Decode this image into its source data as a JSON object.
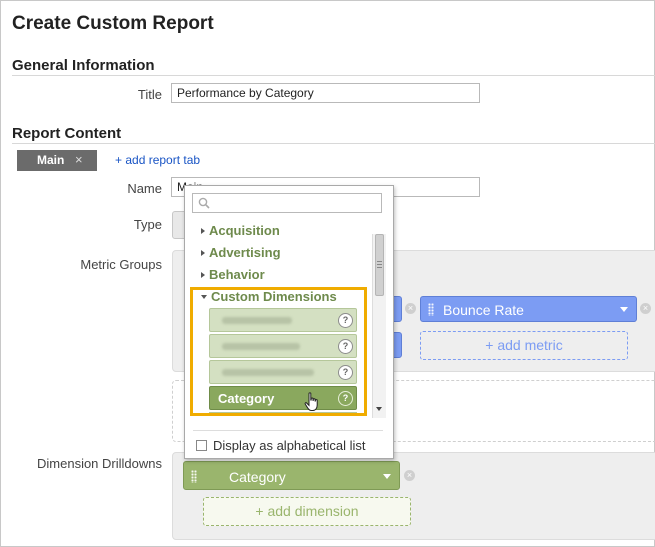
{
  "page": {
    "title": "Create Custom Report",
    "general_section": "General Information",
    "content_section": "Report Content"
  },
  "general": {
    "title_label": "Title",
    "title_value": "Performance by Category"
  },
  "tabs": {
    "active_tab": "Main",
    "close_glyph": "×",
    "add_tab": "+ add report tab"
  },
  "content": {
    "name_label": "Name",
    "name_value": "Main",
    "type_label": "Type",
    "metric_groups_label": "Metric Groups",
    "dimension_drilldowns_label": "Dimension Drilldowns"
  },
  "metrics": {
    "bounce_rate": "Bounce Rate",
    "add_metric": "+ add metric"
  },
  "dimensions": {
    "selected": "Category",
    "add_dimension": "+ add dimension"
  },
  "dropdown": {
    "categories": [
      "Acquisition",
      "Advertising",
      "Behavior"
    ],
    "expanded_category": "Custom Dimensions",
    "selected_item": "Category",
    "help_glyph": "?",
    "footer_option": "Display as alphabetical list"
  },
  "colors": {
    "highlight": "#f0ac00",
    "metric_chip": "#7c9cf3",
    "dimension_chip": "#9ab56d"
  }
}
